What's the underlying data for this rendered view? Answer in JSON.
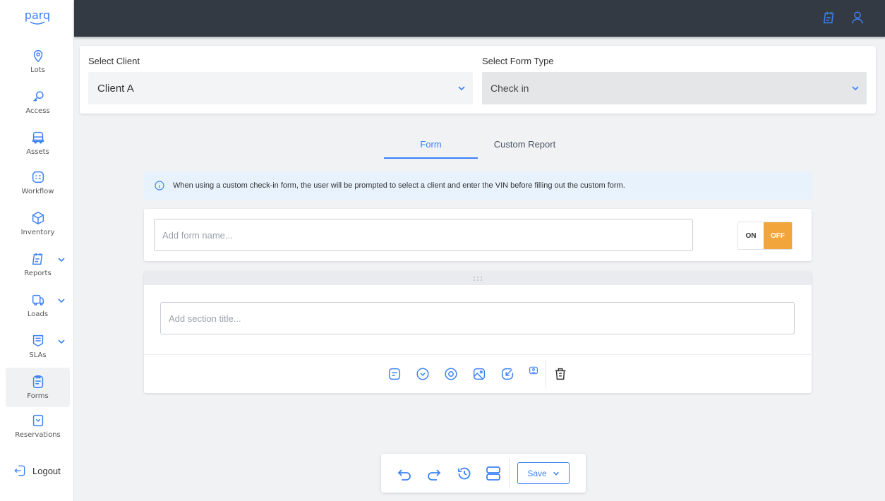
{
  "brand": {
    "logo_text": "parq",
    "accent": "#3b82f6",
    "topbar_bg": "#343a43"
  },
  "sidebar": {
    "items": [
      {
        "label": "Lots",
        "icon": "map-pin-icon"
      },
      {
        "label": "Access",
        "icon": "key-icon"
      },
      {
        "label": "Assets",
        "icon": "truck-icon"
      },
      {
        "label": "Workflow",
        "icon": "workflow-icon"
      },
      {
        "label": "Inventory",
        "icon": "box-icon"
      },
      {
        "label": "Reports",
        "icon": "report-icon",
        "expandable": true
      },
      {
        "label": "Loads",
        "icon": "loads-icon",
        "expandable": true
      },
      {
        "label": "SLAs",
        "icon": "sla-icon",
        "expandable": true
      },
      {
        "label": "Forms",
        "icon": "forms-icon",
        "active": true
      },
      {
        "label": "Reservations",
        "icon": "reservations-icon"
      }
    ],
    "logout_label": "Logout"
  },
  "topbar": {
    "icons": [
      "report-icon",
      "user-icon"
    ]
  },
  "selectors": {
    "client": {
      "label": "Select Client",
      "value": "Client A"
    },
    "form_type": {
      "label": "Select Form Type",
      "value": "Check in"
    }
  },
  "tabs": [
    {
      "label": "Form",
      "active": true
    },
    {
      "label": "Custom Report",
      "active": false
    }
  ],
  "info_banner": {
    "text": "When using a custom check-in form, the user will be prompted to select a client and enter the VIN before filling out the custom form."
  },
  "form_name": {
    "placeholder": "Add form name...",
    "value": ""
  },
  "toggle": {
    "on_label": "ON",
    "off_label": "OFF",
    "state": "OFF",
    "off_color": "#f2a53b"
  },
  "section": {
    "title_placeholder": "Add section title...",
    "tools": [
      "text-field-icon",
      "dropdown-icon",
      "radio-icon",
      "image-icon",
      "signature-icon",
      "photo-capture-icon",
      "trash-icon"
    ]
  },
  "bottom_toolbar": {
    "tools": [
      "undo-icon",
      "redo-icon",
      "history-icon",
      "layout-icon"
    ],
    "save_label": "Save"
  }
}
